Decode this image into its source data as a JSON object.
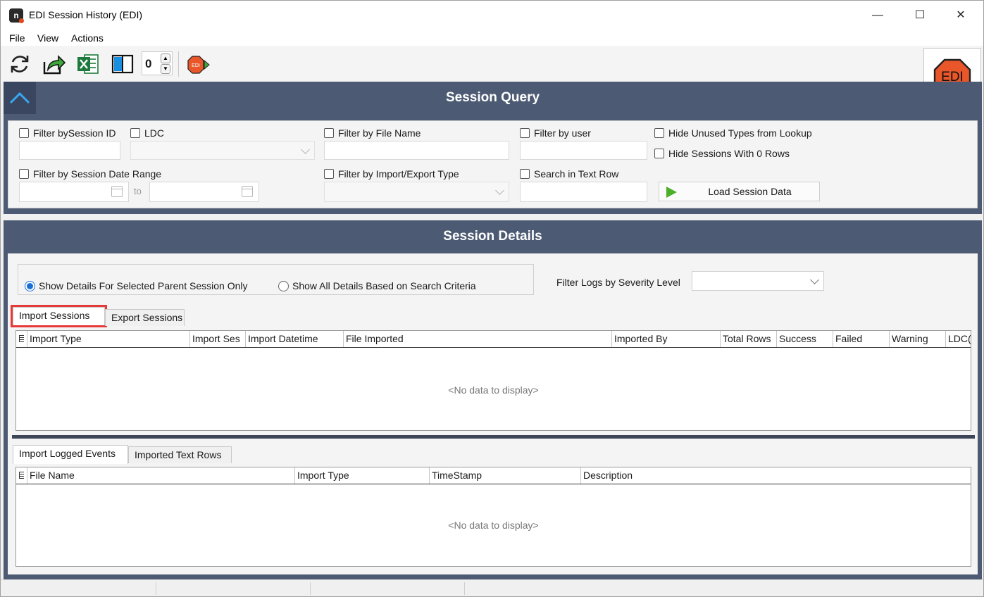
{
  "window": {
    "title": "EDI Session History (EDI)",
    "app_icon": "n",
    "minimize_glyph": "—",
    "maximize_glyph": "☐",
    "close_glyph": "✕"
  },
  "menu": {
    "items": [
      "File",
      "View",
      "Actions"
    ]
  },
  "toolbar": {
    "buttons": [
      "refresh-icon",
      "export-arrow-icon",
      "excel-icon",
      "panel-toggle-icon",
      "edi-forward-icon"
    ],
    "spinner_value": "0",
    "logo_text": "EDI",
    "small_logo_text": "EDI"
  },
  "query": {
    "header": "Session Query",
    "filter_session_id": "Filter bySession ID",
    "ldc": "LDC",
    "filter_file_name": "Filter by File Name",
    "filter_user": "Filter by user",
    "hide_unused_types": "Hide Unused Types from Lookup",
    "hide_sessions_zero": "Hide Sessions With 0 Rows",
    "filter_date_range": "Filter by Session Date Range",
    "date_to": "to",
    "filter_import_export_type": "Filter by Import/Export Type",
    "search_text_row": "Search in Text Row",
    "load_button": "Load Session Data"
  },
  "details": {
    "header": "Session Details",
    "radio_selected_parent": "Show Details For Selected Parent Session Only",
    "radio_all_details": "Show All Details Based on Search Criteria",
    "severity_label": "Filter Logs by Severity Level",
    "tabs_top": [
      "Import Sessions",
      "Export Sessions"
    ],
    "grid_top_columns": [
      "Import Type",
      "Import Ses",
      "Import Datetime",
      "File Imported",
      "Imported By",
      "Total Rows",
      "Success",
      "Failed",
      "Warning",
      "LDC(s"
    ],
    "no_data": "<No data to display>",
    "tabs_bottom": [
      "Import Logged Events",
      "Imported Text Rows"
    ],
    "grid_bottom_columns": [
      "File Name",
      "Import Type",
      "TimeStamp",
      "Description"
    ]
  },
  "colors": {
    "header_bg": "#4c5a73",
    "highlight": "#e53a3a",
    "radio_accent": "#1a6fd6",
    "edi_orange": "#e8562a"
  }
}
